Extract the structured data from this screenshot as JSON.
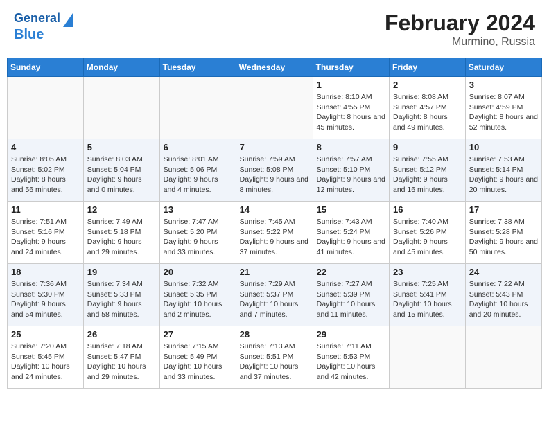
{
  "header": {
    "logo_line1": "General",
    "logo_line2": "Blue",
    "title": "February 2024",
    "subtitle": "Murmino, Russia"
  },
  "columns": [
    "Sunday",
    "Monday",
    "Tuesday",
    "Wednesday",
    "Thursday",
    "Friday",
    "Saturday"
  ],
  "weeks": [
    [
      {
        "day": "",
        "info": ""
      },
      {
        "day": "",
        "info": ""
      },
      {
        "day": "",
        "info": ""
      },
      {
        "day": "",
        "info": ""
      },
      {
        "day": "1",
        "info": "Sunrise: 8:10 AM\nSunset: 4:55 PM\nDaylight: 8 hours and 45 minutes."
      },
      {
        "day": "2",
        "info": "Sunrise: 8:08 AM\nSunset: 4:57 PM\nDaylight: 8 hours and 49 minutes."
      },
      {
        "day": "3",
        "info": "Sunrise: 8:07 AM\nSunset: 4:59 PM\nDaylight: 8 hours and 52 minutes."
      }
    ],
    [
      {
        "day": "4",
        "info": "Sunrise: 8:05 AM\nSunset: 5:02 PM\nDaylight: 8 hours and 56 minutes."
      },
      {
        "day": "5",
        "info": "Sunrise: 8:03 AM\nSunset: 5:04 PM\nDaylight: 9 hours and 0 minutes."
      },
      {
        "day": "6",
        "info": "Sunrise: 8:01 AM\nSunset: 5:06 PM\nDaylight: 9 hours and 4 minutes."
      },
      {
        "day": "7",
        "info": "Sunrise: 7:59 AM\nSunset: 5:08 PM\nDaylight: 9 hours and 8 minutes."
      },
      {
        "day": "8",
        "info": "Sunrise: 7:57 AM\nSunset: 5:10 PM\nDaylight: 9 hours and 12 minutes."
      },
      {
        "day": "9",
        "info": "Sunrise: 7:55 AM\nSunset: 5:12 PM\nDaylight: 9 hours and 16 minutes."
      },
      {
        "day": "10",
        "info": "Sunrise: 7:53 AM\nSunset: 5:14 PM\nDaylight: 9 hours and 20 minutes."
      }
    ],
    [
      {
        "day": "11",
        "info": "Sunrise: 7:51 AM\nSunset: 5:16 PM\nDaylight: 9 hours and 24 minutes."
      },
      {
        "day": "12",
        "info": "Sunrise: 7:49 AM\nSunset: 5:18 PM\nDaylight: 9 hours and 29 minutes."
      },
      {
        "day": "13",
        "info": "Sunrise: 7:47 AM\nSunset: 5:20 PM\nDaylight: 9 hours and 33 minutes."
      },
      {
        "day": "14",
        "info": "Sunrise: 7:45 AM\nSunset: 5:22 PM\nDaylight: 9 hours and 37 minutes."
      },
      {
        "day": "15",
        "info": "Sunrise: 7:43 AM\nSunset: 5:24 PM\nDaylight: 9 hours and 41 minutes."
      },
      {
        "day": "16",
        "info": "Sunrise: 7:40 AM\nSunset: 5:26 PM\nDaylight: 9 hours and 45 minutes."
      },
      {
        "day": "17",
        "info": "Sunrise: 7:38 AM\nSunset: 5:28 PM\nDaylight: 9 hours and 50 minutes."
      }
    ],
    [
      {
        "day": "18",
        "info": "Sunrise: 7:36 AM\nSunset: 5:30 PM\nDaylight: 9 hours and 54 minutes."
      },
      {
        "day": "19",
        "info": "Sunrise: 7:34 AM\nSunset: 5:33 PM\nDaylight: 9 hours and 58 minutes."
      },
      {
        "day": "20",
        "info": "Sunrise: 7:32 AM\nSunset: 5:35 PM\nDaylight: 10 hours and 2 minutes."
      },
      {
        "day": "21",
        "info": "Sunrise: 7:29 AM\nSunset: 5:37 PM\nDaylight: 10 hours and 7 minutes."
      },
      {
        "day": "22",
        "info": "Sunrise: 7:27 AM\nSunset: 5:39 PM\nDaylight: 10 hours and 11 minutes."
      },
      {
        "day": "23",
        "info": "Sunrise: 7:25 AM\nSunset: 5:41 PM\nDaylight: 10 hours and 15 minutes."
      },
      {
        "day": "24",
        "info": "Sunrise: 7:22 AM\nSunset: 5:43 PM\nDaylight: 10 hours and 20 minutes."
      }
    ],
    [
      {
        "day": "25",
        "info": "Sunrise: 7:20 AM\nSunset: 5:45 PM\nDaylight: 10 hours and 24 minutes."
      },
      {
        "day": "26",
        "info": "Sunrise: 7:18 AM\nSunset: 5:47 PM\nDaylight: 10 hours and 29 minutes."
      },
      {
        "day": "27",
        "info": "Sunrise: 7:15 AM\nSunset: 5:49 PM\nDaylight: 10 hours and 33 minutes."
      },
      {
        "day": "28",
        "info": "Sunrise: 7:13 AM\nSunset: 5:51 PM\nDaylight: 10 hours and 37 minutes."
      },
      {
        "day": "29",
        "info": "Sunrise: 7:11 AM\nSunset: 5:53 PM\nDaylight: 10 hours and 42 minutes."
      },
      {
        "day": "",
        "info": ""
      },
      {
        "day": "",
        "info": ""
      }
    ]
  ]
}
